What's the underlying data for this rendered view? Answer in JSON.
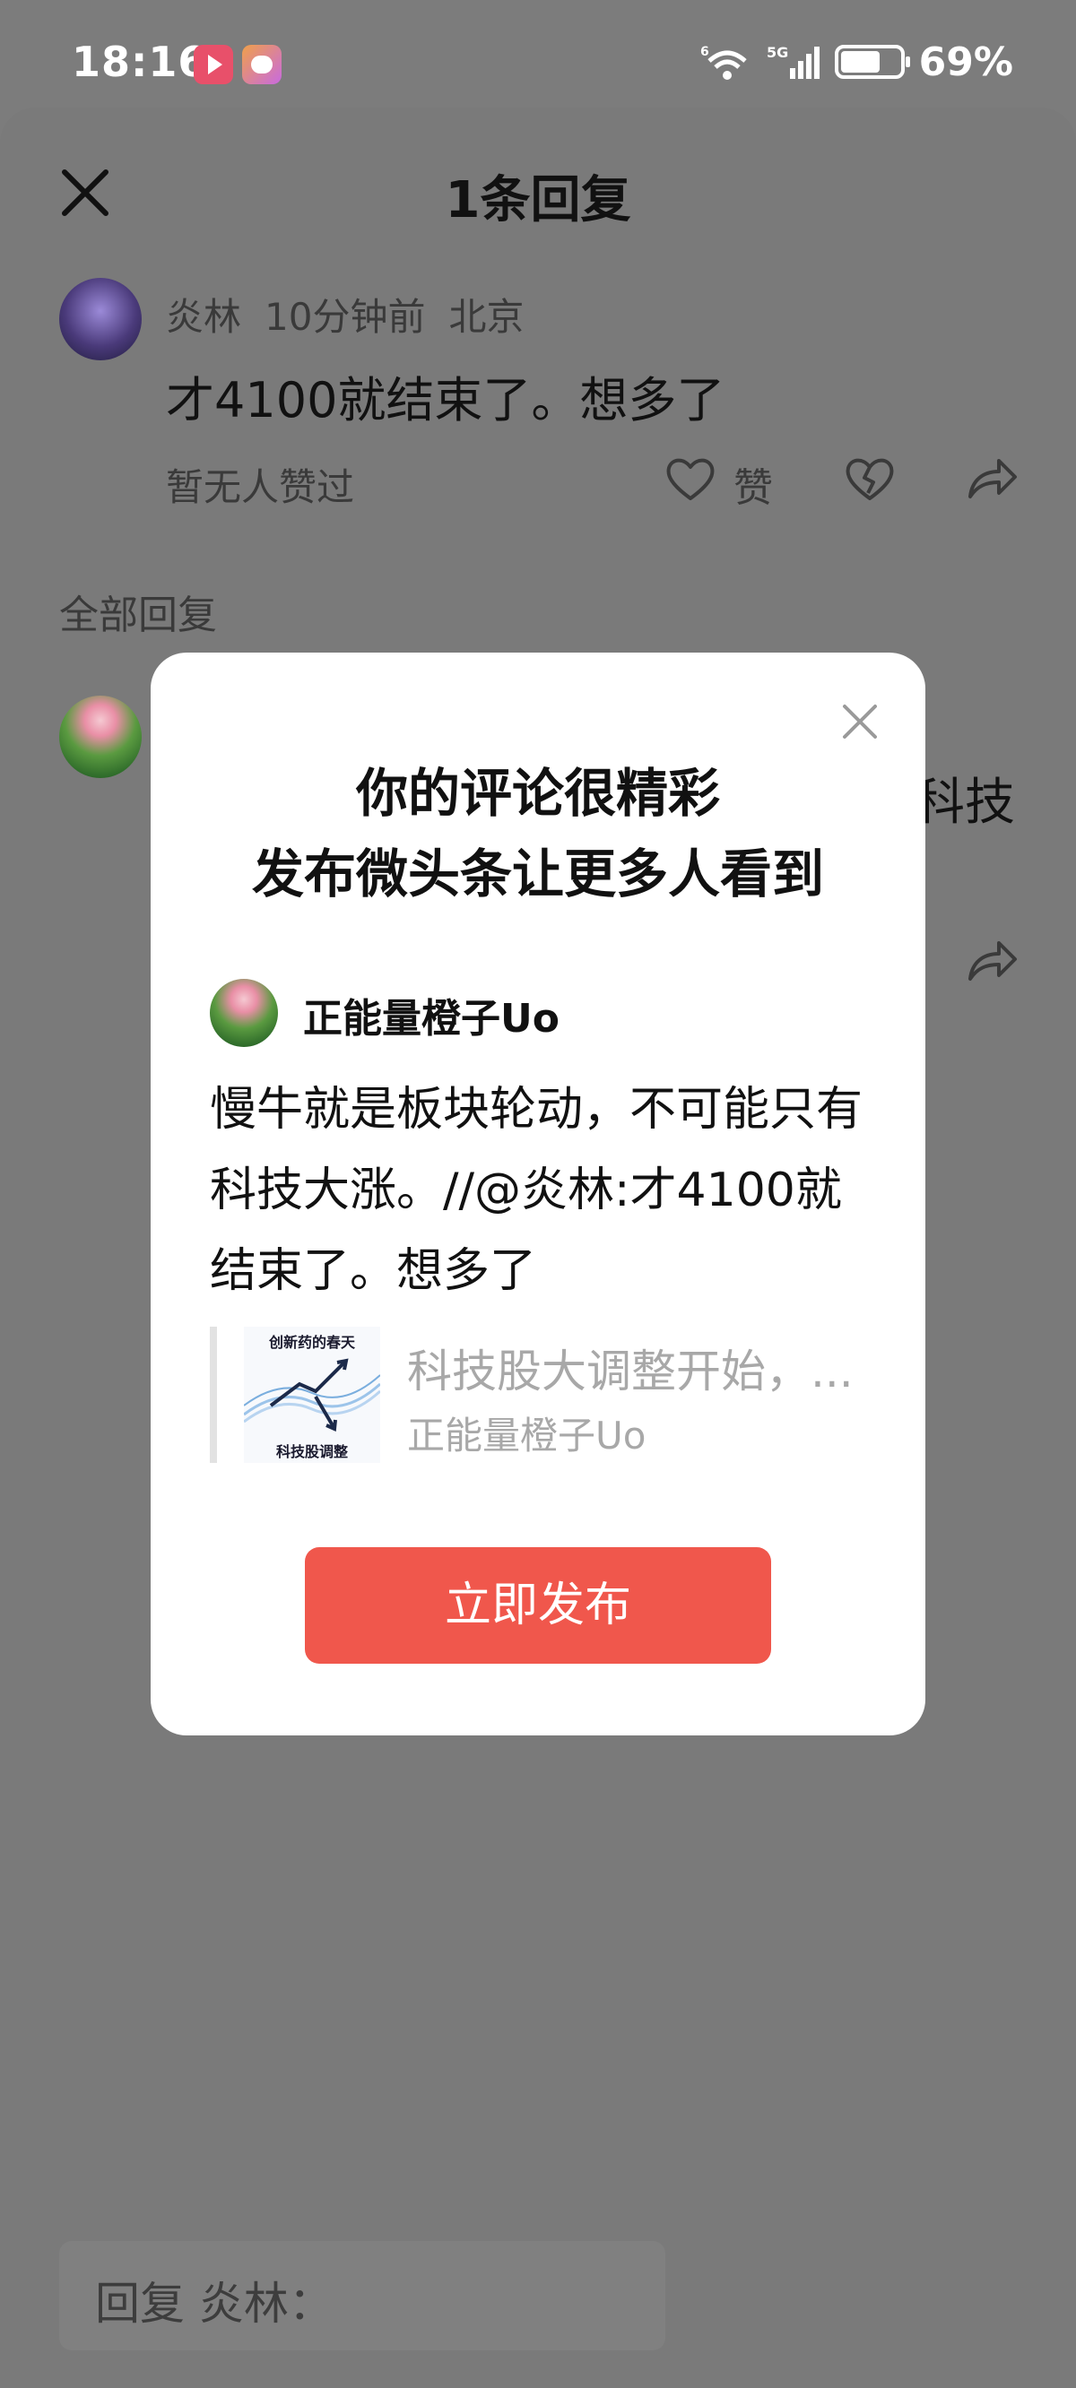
{
  "status_bar": {
    "time": "18:16",
    "battery": "69%",
    "battery_level": 0.69,
    "network_label": "5G",
    "wifi_label": "6"
  },
  "sheet": {
    "title": "1条回复",
    "comment": {
      "author": "炎林",
      "time": "10分钟前",
      "location": "北京",
      "text": "才4100就结束了。想多了",
      "likes_text": "暂无人赞过",
      "like_label": "赞"
    },
    "section_label": "全部回复",
    "peek_text": "科技",
    "reply_placeholder": "回复 炎林："
  },
  "modal": {
    "title_line1": "你的评论很精彩",
    "title_line2": "发布微头条让更多人看到",
    "username": "正能量橙子Uo",
    "body": "慢牛就是板块轮动，不可能只有科技大涨。//@炎林:才4100就结束了。想多了",
    "quote": {
      "thumb_top": "创新药的春天",
      "thumb_bottom": "科技股调整",
      "title": "科技股大调整开始，...",
      "author": "正能量橙子Uo"
    },
    "publish_label": "立即发布"
  },
  "colors": {
    "overlay": "#7c7c7c",
    "accent": "#f0574c",
    "muted_text": "#a8a8a8"
  }
}
